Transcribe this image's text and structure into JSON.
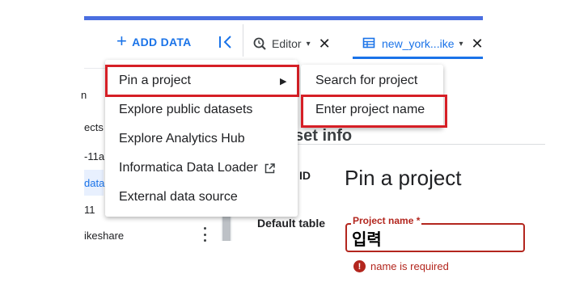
{
  "toolbar": {
    "add_data_label": "ADD DATA",
    "add_data_icon": "+"
  },
  "tabs": [
    {
      "label": "Editor",
      "caret": "▾",
      "close": "✕"
    },
    {
      "label": "new_york...ike",
      "caret": "▾",
      "close": "✕"
    }
  ],
  "explorer": {
    "rows": [
      "n",
      "ects",
      "-11a",
      "data",
      "11",
      "ikeshare"
    ]
  },
  "dataset_panel": {
    "title": "set info",
    "id_label": "ID",
    "default_table_label": "Default table"
  },
  "context_menu": {
    "items": [
      {
        "label": "Pin a project",
        "has_submenu": true,
        "arrow": "▶"
      },
      {
        "label": "Explore public datasets"
      },
      {
        "label": "Explore Analytics Hub"
      },
      {
        "label": "Informatica Data Loader",
        "external_icon": "open-in-new-icon"
      },
      {
        "label": "External data source"
      }
    ]
  },
  "submenu": {
    "items": [
      {
        "label": "Search for project"
      },
      {
        "label": "Enter project name"
      }
    ]
  },
  "dialog": {
    "title": "Pin a project",
    "field_label": "Project name *",
    "field_value": "입력",
    "error_text": "name is required",
    "error_icon": "!"
  },
  "colors": {
    "accent": "#1a73e8",
    "highlight": "#d61f26",
    "error": "#b3261e"
  }
}
